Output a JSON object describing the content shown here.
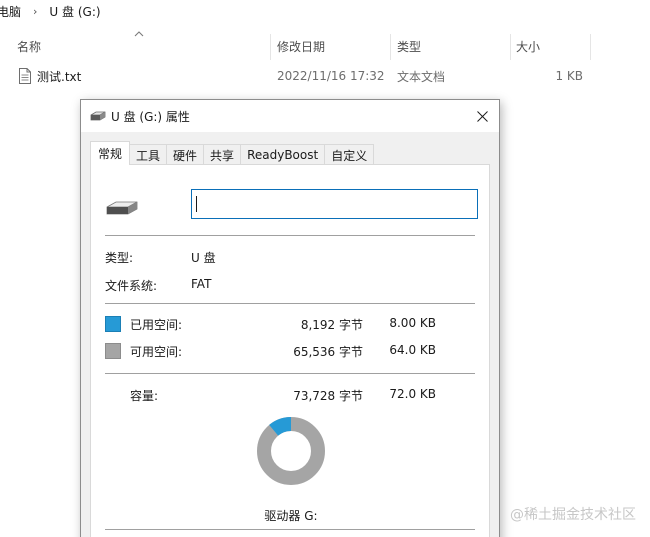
{
  "breadcrumb": {
    "items": [
      "电脑",
      "U 盘 (G:)"
    ]
  },
  "columns": {
    "name": "名称",
    "modified": "修改日期",
    "type": "类型",
    "size": "大小"
  },
  "file": {
    "name": "测试.txt",
    "modified": "2022/11/16 17:32",
    "type": "文本文档",
    "size": "1 KB"
  },
  "dialog": {
    "title": "U 盘 (G:) 属性",
    "tabs": [
      "常规",
      "工具",
      "硬件",
      "共享",
      "ReadyBoost",
      "自定义"
    ],
    "active_tab": 0,
    "name_value": "",
    "type_label": "类型:",
    "type_value": "U 盘",
    "fs_label": "文件系统:",
    "fs_value": "FAT",
    "used_label": "已用空间:",
    "used_bytes": "8,192 字节",
    "used_size": "8.00 KB",
    "free_label": "可用空间:",
    "free_bytes": "65,536 字节",
    "free_size": "64.0 KB",
    "capacity_label": "容量:",
    "capacity_bytes": "73,728 字节",
    "capacity_size": "72.0 KB",
    "drive_label": "驱动器 G:"
  },
  "usage": {
    "used_fraction": 0.111
  },
  "colors": {
    "used": "#269ad6",
    "free": "#a5a5a5",
    "accent": "#0a6fb8"
  },
  "icons": {
    "drive": "usb-drive-icon",
    "file": "text-file-icon",
    "close": "close-icon",
    "sort": "sort-up-icon"
  },
  "watermark": "@稀土掘金技术社区"
}
